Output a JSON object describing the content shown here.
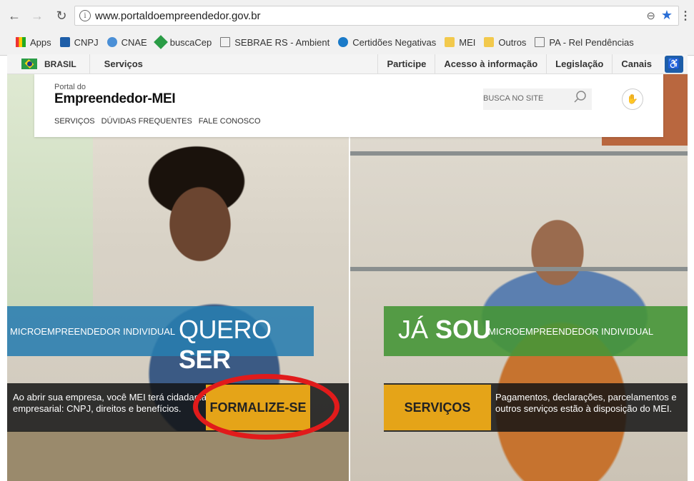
{
  "browser": {
    "url": "www.portaldoempreendedor.gov.br",
    "bookmarks": [
      "Apps",
      "CNPJ",
      "CNAE",
      "buscaCep",
      "SEBRAE RS - Ambient",
      "Certidões Negativas",
      "MEI",
      "Outros",
      "PA - Rel Pendências"
    ]
  },
  "govbar": {
    "brasil": "BRASIL",
    "servicos": "Serviços",
    "links": [
      "Participe",
      "Acesso à informação",
      "Legislação",
      "Canais"
    ]
  },
  "header": {
    "pre_title": "Portal do",
    "title": "Empreendedor-MEI",
    "nav": [
      "SERVIÇOS",
      "DÚVIDAS FREQUENTES",
      "FALE CONOSCO"
    ],
    "search_placeholder": "BUSCA NO SITE"
  },
  "left": {
    "small": "MICROEMPREENDEDOR INDIVIDUAL",
    "big_normal": "QUERO ",
    "big_bold": "SER",
    "info_line1": "Ao abrir sua empresa, você MEI terá cidadania",
    "info_line2": "empresarial: CNPJ, direitos e benefícios.",
    "button": "FORMALIZE-SE"
  },
  "right": {
    "big_normal": "JÁ ",
    "big_bold": "SOU",
    "small": "MICROEMPREENDEDOR INDIVIDUAL",
    "info_line1": "Pagamentos, declarações, parcelamentos e",
    "info_line2": "outros serviços estão à disposição do MEI.",
    "button": "SERVIÇOS"
  }
}
